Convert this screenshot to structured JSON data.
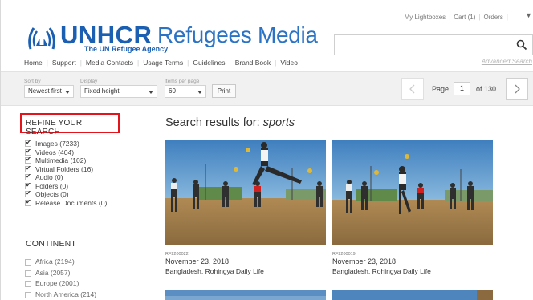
{
  "header": {
    "logo_word": "UNHCR",
    "logo_tagline": "The UN Refugee Agency",
    "site_title": "Refugees Media",
    "top_links": [
      "My Lightboxes",
      "Cart (1)",
      "Orders"
    ],
    "advanced_search": "Advanced Search",
    "search": {
      "value": "",
      "placeholder": ""
    },
    "nav": [
      "Home",
      "Support",
      "Media Contacts",
      "Usage Terms",
      "Guidelines",
      "Brand Book",
      "Video"
    ],
    "brand_color": "#1b5fb3"
  },
  "toolbar": {
    "sort_label": "Sort by",
    "sort_value": "Newest first",
    "display_label": "Display",
    "display_value": "Fixed height",
    "per_page_label": "Items per page",
    "per_page_value": "60",
    "print_label": "Print",
    "page_label": "Page",
    "page_value": "1",
    "page_of": "of 130"
  },
  "sidebar": {
    "refine_title": "REFINE YOUR SEARCH",
    "types": [
      {
        "label": "Images (7233)",
        "checked": true
      },
      {
        "label": "Videos (404)",
        "checked": true
      },
      {
        "label": "Multimedia (102)",
        "checked": true
      },
      {
        "label": "Virtual Folders (16)",
        "checked": true
      },
      {
        "label": "Audio (0)",
        "checked": true
      },
      {
        "label": "Folders (0)",
        "checked": true
      },
      {
        "label": "Objects (0)",
        "checked": true
      },
      {
        "label": "Release Documents (0)",
        "checked": true
      }
    ],
    "continent_title": "CONTINENT",
    "continents": [
      {
        "label": "Africa (2194)",
        "checked": false
      },
      {
        "label": "Asia (2057)",
        "checked": false
      },
      {
        "label": "Europe (2001)",
        "checked": false
      },
      {
        "label": "North America (214)",
        "checked": false
      }
    ]
  },
  "results": {
    "heading_prefix": "Search results for: ",
    "query": "sports",
    "cards": [
      {
        "id": "RF2200022",
        "date": "November 23, 2018",
        "caption": "Bangladesh. Rohingya Daily Life"
      },
      {
        "id": "RF2200019",
        "date": "November 23, 2018",
        "caption": "Bangladesh. Rohingya Daily Life"
      }
    ]
  }
}
